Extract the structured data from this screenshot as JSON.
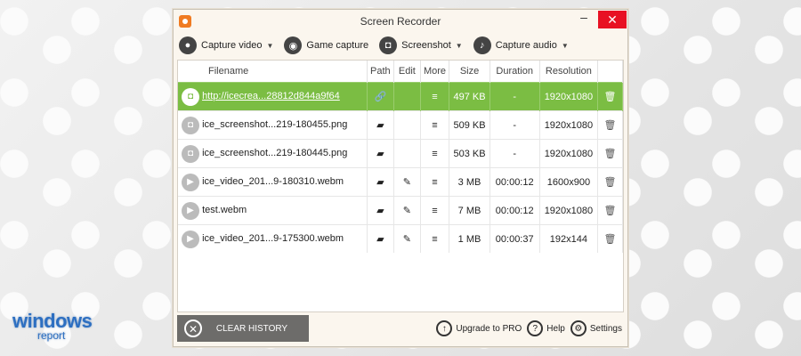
{
  "window": {
    "title": "Screen Recorder",
    "minimize": "–",
    "close": "✕"
  },
  "toolbar": {
    "items": [
      {
        "label": "Capture video",
        "icon": "●"
      },
      {
        "label": "Game capture",
        "icon": "◉"
      },
      {
        "label": "Screenshot",
        "icon": "◘"
      },
      {
        "label": "Capture audio",
        "icon": "♪"
      }
    ]
  },
  "table": {
    "headers": [
      "Filename",
      "Path",
      "Edit",
      "More",
      "Size",
      "Duration",
      "Resolution"
    ],
    "rows": [
      {
        "icon": "◘",
        "filename": "http://icecrea...28812d844a9f64",
        "path": "🔗",
        "edit": "",
        "more": "≡",
        "size": "497 KB",
        "duration": "-",
        "resolution": "1920x1080",
        "delete": "🗑"
      },
      {
        "icon": "◘",
        "filename": "ice_screenshot...219-180455.png",
        "path": "▰",
        "edit": "",
        "more": "≡",
        "size": "509 KB",
        "duration": "-",
        "resolution": "1920x1080",
        "delete": "🗑"
      },
      {
        "icon": "◘",
        "filename": "ice_screenshot...219-180445.png",
        "path": "▰",
        "edit": "",
        "more": "≡",
        "size": "503 KB",
        "duration": "-",
        "resolution": "1920x1080",
        "delete": "🗑"
      },
      {
        "icon": "▶",
        "filename": "ice_video_201...9-180310.webm",
        "path": "▰",
        "edit": "✎",
        "more": "≡",
        "size": "3 MB",
        "duration": "00:00:12",
        "resolution": "1600x900",
        "delete": "🗑"
      },
      {
        "icon": "▶",
        "filename": "test.webm",
        "path": "▰",
        "edit": "✎",
        "more": "≡",
        "size": "7 MB",
        "duration": "00:00:12",
        "resolution": "1920x1080",
        "delete": "🗑"
      },
      {
        "icon": "▶",
        "filename": "ice_video_201...9-175300.webm",
        "path": "▰",
        "edit": "✎",
        "more": "≡",
        "size": "1 MB",
        "duration": "00:00:37",
        "resolution": "192x144",
        "delete": "🗑"
      }
    ]
  },
  "bottom": {
    "clear_history": "CLEAR HISTORY",
    "upgrade": "Upgrade to PRO",
    "help": "Help",
    "settings": "Settings"
  },
  "brand": {
    "line1": "windows",
    "line2": "report"
  }
}
